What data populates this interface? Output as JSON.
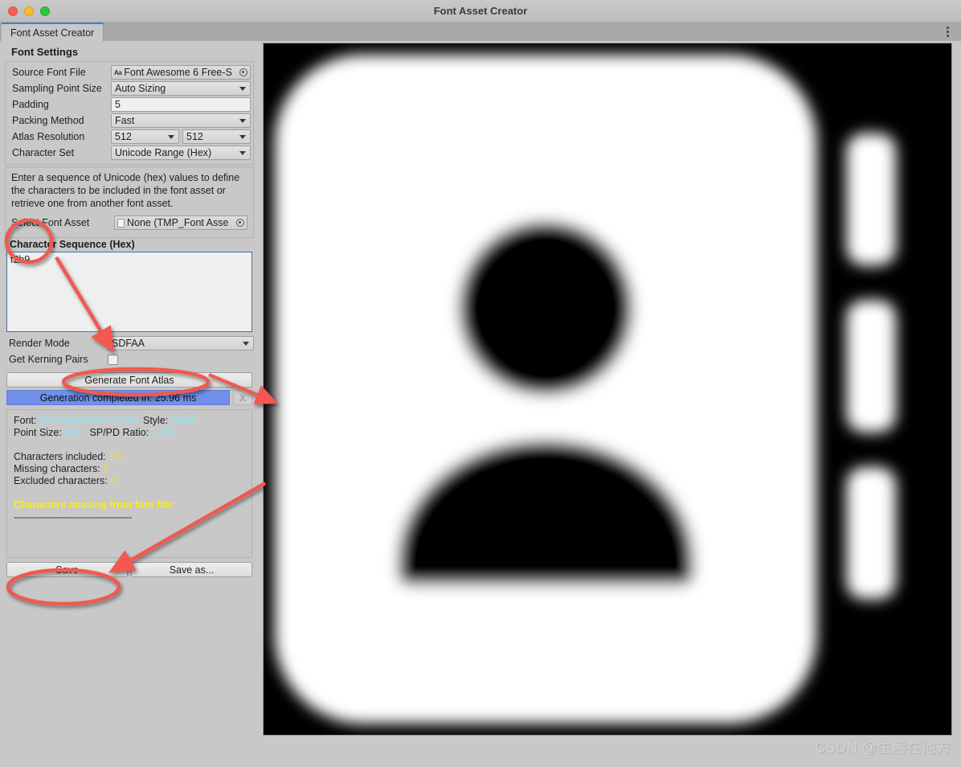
{
  "window": {
    "title": "Font Asset Creator",
    "traffic_lights": [
      "close-red",
      "minimize-yellow",
      "zoom-green"
    ],
    "menu_icon": "kebab-menu-icon"
  },
  "tab": {
    "label": "Font Asset Creator"
  },
  "panel": {
    "section_title": "Font Settings",
    "fields": [
      {
        "label": "Source Font File",
        "value": "Font Awesome 6 Free-S",
        "kind": "object",
        "icon": "font-aa-icon"
      },
      {
        "label": "Sampling Point Size",
        "value": "Auto Sizing",
        "kind": "dropdown"
      },
      {
        "label": "Padding",
        "value": "5",
        "kind": "text"
      },
      {
        "label": "Packing Method",
        "value": "Fast",
        "kind": "dropdown"
      },
      {
        "label": "Atlas Resolution",
        "value": "512",
        "value2": "512",
        "kind": "dropdown2"
      },
      {
        "label": "Character Set",
        "value": "Unicode Range (Hex)",
        "kind": "dropdown"
      }
    ],
    "help_text": "Enter a sequence of Unicode (hex) values to define the characters to be included in the font asset or retrieve one from another font asset.",
    "select_font_asset": {
      "label": "Select Font Asset",
      "value": "None (TMP_Font Asse",
      "icon": "document-icon"
    },
    "character_sequence": {
      "label": "Character Sequence (Hex)",
      "value": "f2b9"
    },
    "render_mode": {
      "label": "Render Mode",
      "value": "SDFAA"
    },
    "kerning": {
      "label": "Get Kerning Pairs",
      "checked": false
    },
    "generate_button": "Generate Font Atlas",
    "progress": {
      "text": "Generation completed in: 25.96 ms",
      "cancel": "X",
      "percent": 100,
      "color": "#6f8fe8"
    },
    "info": {
      "font_label": "Font:",
      "font_value": "Font Awesome 6 Free",
      "style_label": "Style:",
      "style_value": "Solid",
      "point_size_label": "Point Size:",
      "point_size_value": "499",
      "ratio_label": "SP/PD Ratio:",
      "ratio_value": "1.0%",
      "included_label": "Characters included:",
      "included_value": "1/1",
      "missing_label": "Missing characters:",
      "missing_value": "0",
      "excluded_label": "Excluded characters:",
      "excluded_value": "0",
      "missing_from_file": "Characters missing from font file:",
      "divider": "------------------------------------------",
      "value_color": "#8fe4f2",
      "count_color": "#ffe000"
    },
    "save_button": "Save",
    "save_as_button": "Save as..."
  },
  "preview": {
    "glyph_name": "address-book-icon",
    "unicode": "f2b9",
    "background": "#000000",
    "glyph_color": "#ffffff"
  },
  "annotations": {
    "color": "#f2584f",
    "shapes": [
      {
        "name": "ellipse-character-sequence",
        "type": "ellipse"
      },
      {
        "name": "ellipse-generate-font-atlas",
        "type": "ellipse"
      },
      {
        "name": "ellipse-save",
        "type": "ellipse"
      },
      {
        "name": "arrow-sequence-to-rendermode",
        "type": "arrow"
      },
      {
        "name": "arrow-generate-to-preview",
        "type": "arrow"
      },
      {
        "name": "arrow-preview-to-save",
        "type": "arrow"
      }
    ]
  },
  "watermark": {
    "text": "CSDN @生活在他方"
  }
}
